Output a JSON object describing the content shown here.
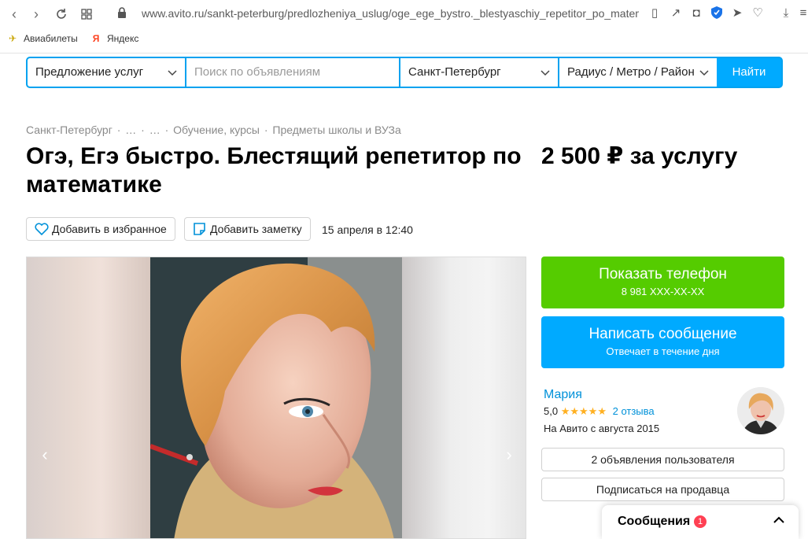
{
  "browser": {
    "url_domain": "www.avito.ru",
    "url_path": "/sankt-peterburg/predlozheniya_uslug/oge_ege_bystro._blestyaschiy_repetitor_po_matem",
    "bookmarks": [
      {
        "label": "Авиабилеты",
        "icon": "plane-icon"
      },
      {
        "label": "Яндекс",
        "icon": "yandex-icon"
      }
    ]
  },
  "search": {
    "category": "Предложение услуг",
    "placeholder": "Поиск по объявлениям",
    "city": "Санкт-Петербург",
    "radius": "Радиус / Метро / Район",
    "submit": "Найти"
  },
  "breadcrumbs": [
    "Санкт-Петербург",
    "·",
    "…",
    "·",
    "…",
    "·",
    "Обучение, курсы",
    "·",
    "Предметы школы и ВУЗа"
  ],
  "listing": {
    "title": "Огэ, Егэ быстро. Блестящий репетитор по математике",
    "price": "2 500 ₽ за услугу",
    "favorite_label": "Добавить в избранное",
    "note_label": "Добавить заметку",
    "date": "15 апреля в 12:40"
  },
  "contact": {
    "show_phone": "Показать телефон",
    "phone": "8 981 XXX-XX-XX",
    "write_message": "Написать сообщение",
    "reply_time": "Отвечает в течение дня"
  },
  "seller": {
    "name": "Мария",
    "rating": "5,0",
    "stars": "★★★★★",
    "reviews": "2 отзыва",
    "since": "На Авито с августа 2015",
    "other_ads": "2 объявления пользователя",
    "subscribe": "Подписаться на продавца"
  },
  "messages": {
    "label": "Сообщения",
    "count": "1"
  },
  "colors": {
    "accent_blue": "#00aaff",
    "green": "#55cc00",
    "link": "#0091d9",
    "star": "#ffb021",
    "badge": "#ff4053"
  }
}
